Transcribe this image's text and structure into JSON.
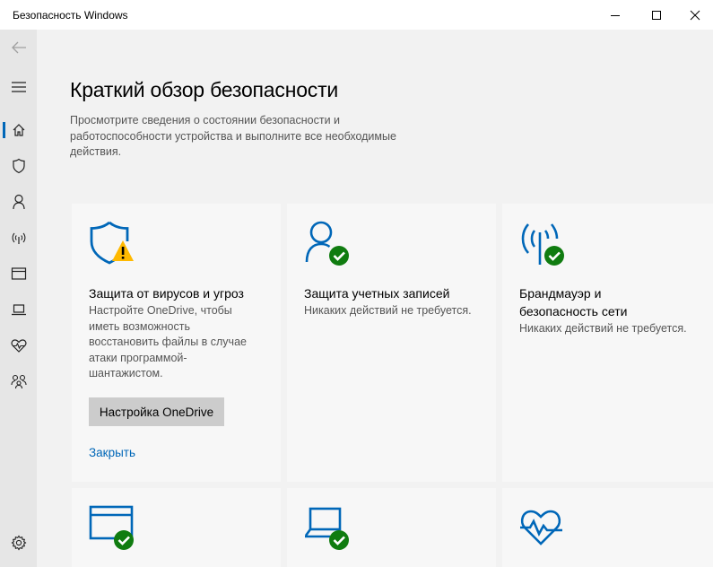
{
  "window": {
    "title": "Безопасность Windows"
  },
  "colors": {
    "accent": "#0067b8",
    "ok": "#107c10",
    "warning": "#ffb900",
    "sidebar": "#e6e6e6",
    "background": "#f2f2f2"
  },
  "sidebar": {
    "items": [
      {
        "icon": "back-arrow-icon"
      },
      {
        "icon": "hamburger-menu-icon"
      },
      {
        "icon": "home-icon",
        "active": true
      },
      {
        "icon": "shield-icon"
      },
      {
        "icon": "person-icon"
      },
      {
        "icon": "wireless-antenna-icon"
      },
      {
        "icon": "app-browser-window-icon"
      },
      {
        "icon": "laptop-icon"
      },
      {
        "icon": "heart-pulse-icon"
      },
      {
        "icon": "family-icon"
      },
      {
        "icon": "gear-icon"
      }
    ]
  },
  "main": {
    "title": "Краткий обзор безопасности",
    "description": "Просмотрите сведения о состоянии безопасности и работоспособности устройства и выполните все необходимые действия.",
    "cards": [
      {
        "icon": "virus-shield-warning-icon",
        "title": "Защита от вирусов и угроз",
        "text": "Настройте OneDrive, чтобы иметь возможность восстановить файлы в случае атаки программой-шантажистом.",
        "button": "Настройка OneDrive",
        "link": "Закрыть"
      },
      {
        "icon": "account-protection-ok-icon",
        "title": "Защита учетных записей",
        "text": "Никаких действий не требуется."
      },
      {
        "icon": "firewall-ok-icon",
        "title": "Брандмауэр и безопасность сети",
        "text": "Никаких действий не требуется."
      },
      {
        "icon": "app-browser-control-ok-icon"
      },
      {
        "icon": "device-security-ok-icon"
      },
      {
        "icon": "device-health-icon"
      }
    ]
  }
}
